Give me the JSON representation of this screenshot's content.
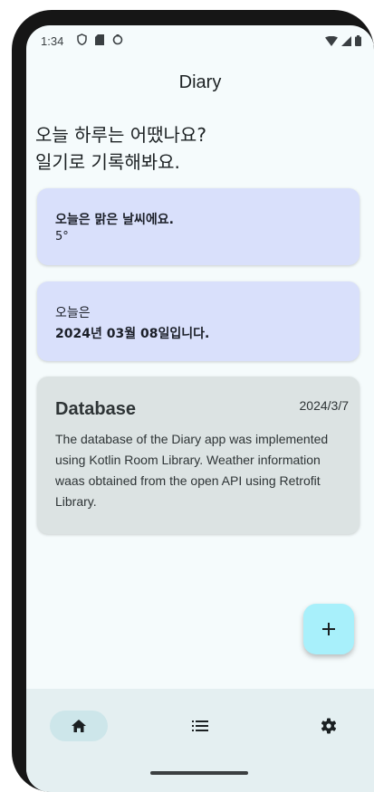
{
  "status_bar": {
    "time": "1:34",
    "left_icons": [
      "vpn-shield-icon",
      "sd-card-icon",
      "data-saver-icon"
    ],
    "right_icons": [
      "wifi-icon",
      "cell-signal-icon",
      "battery-icon"
    ]
  },
  "header": {
    "title": "Diary"
  },
  "greeting": {
    "line1": "오늘 하루는 어땠나요?",
    "line2": "일기로 기록해봐요."
  },
  "weather_card": {
    "message": "오늘은 맑은 날씨에요.",
    "temperature": "5°"
  },
  "date_card": {
    "prefix": "오늘은",
    "date_text": "2024년 03월 08일입니다."
  },
  "entries": [
    {
      "title": "Database",
      "date": "2024/3/7",
      "body": "The database of the Diary app was implemented using Kotlin Room Library. Weather information waas obtained from the open API using Retrofit Library."
    }
  ],
  "fab": {
    "icon": "plus-icon",
    "label": "+"
  },
  "bottom_nav": {
    "items": [
      {
        "icon": "home-icon",
        "selected": true
      },
      {
        "icon": "list-icon",
        "selected": false
      },
      {
        "icon": "gear-icon",
        "selected": false
      }
    ]
  },
  "colors": {
    "background": "#f5fbfc",
    "info_card": "#d9e0fb",
    "entry_card": "#dce3e3",
    "fab": "#a8f0fb",
    "nav_background": "#e4eff1",
    "nav_selected": "#cde6ea"
  }
}
